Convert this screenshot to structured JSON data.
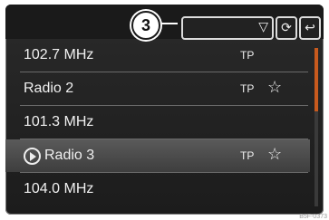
{
  "header": {
    "callout": "3",
    "dropdown_icon": "triangle-down-icon",
    "refresh_icon": "refresh-icon",
    "back_icon": "back-icon"
  },
  "stations": [
    {
      "label": "102.7 MHz",
      "tp": "TP",
      "star": false,
      "selected": false
    },
    {
      "label": "Radio 2",
      "tp": "TP",
      "star": true,
      "selected": false
    },
    {
      "label": "101.3 MHz",
      "tp": "",
      "star": false,
      "selected": false
    },
    {
      "label": "Radio 3",
      "tp": "TP",
      "star": true,
      "selected": true
    },
    {
      "label": "104.0 MHz",
      "tp": "",
      "star": false,
      "selected": false
    }
  ],
  "footer_code": "B5F-0373",
  "colors": {
    "scroll_thumb": "#c85a1e"
  }
}
